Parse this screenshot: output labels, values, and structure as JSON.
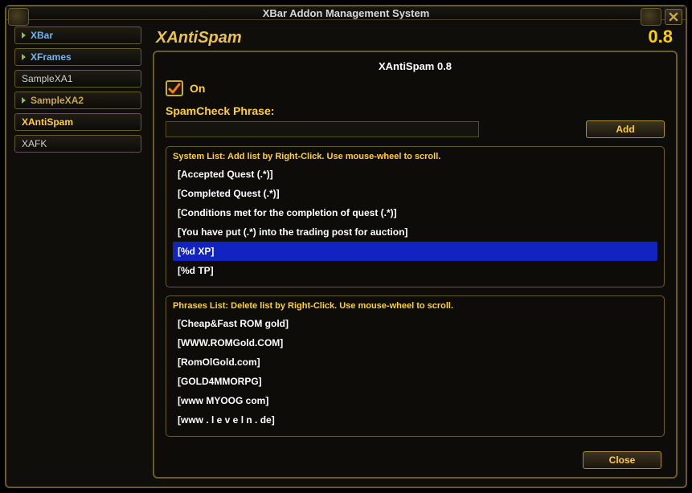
{
  "window_title": "XBar Addon Management System",
  "sidebar": {
    "items": [
      {
        "label": "XBar",
        "style": "blue",
        "arrow": true
      },
      {
        "label": "XFrames",
        "style": "blue",
        "arrow": true
      },
      {
        "label": "SampleXA1",
        "style": "plain",
        "arrow": false
      },
      {
        "label": "SampleXA2",
        "style": "bluegold",
        "arrow": true
      },
      {
        "label": "XAntiSpam",
        "style": "selected",
        "arrow": false
      },
      {
        "label": "XAFK",
        "style": "plain",
        "arrow": false
      }
    ]
  },
  "addon": {
    "name": "XAntiSpam",
    "version": "0.8",
    "title_combined": "XAntiSpam 0.8"
  },
  "on_toggle": {
    "label": "On",
    "checked": true
  },
  "phrase_input": {
    "label": "SpamCheck Phrase:",
    "value": "",
    "add_button": "Add"
  },
  "system_list": {
    "hint": "System List: Add list by Right-Click. Use mouse-wheel to scroll.",
    "items": [
      "[Accepted Quest (.*)]",
      "[Completed Quest (.*)]",
      "[Conditions met for the completion of quest  (.*)]",
      "[You have put (.*) into the trading post for auction]",
      "[%d XP]",
      "[%d TP]"
    ],
    "selected_index": 4
  },
  "phrases_list": {
    "hint": "Phrases List: Delete list by Right-Click. Use mouse-wheel to scroll.",
    "items": [
      "[Cheap&Fast ROM gold]",
      "[WWW.ROMGold.COM]",
      "[RomOlGold.com]",
      "[GOLD4MMORPG]",
      "[www MYOOG com]",
      "[www . l e v e l n . de]"
    ],
    "selected_index": -1
  },
  "close_button": "Close"
}
